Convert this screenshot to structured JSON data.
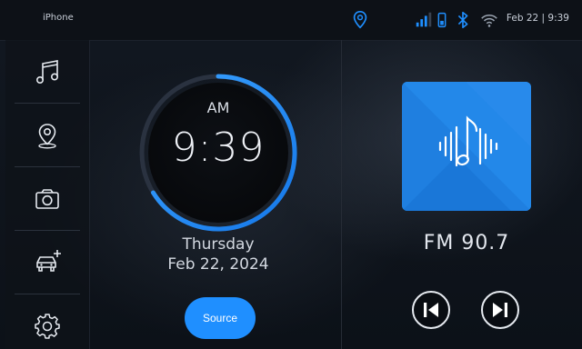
{
  "status_bar": {
    "device_name": "iPhone",
    "date_time": "Feb 22 | 9:39",
    "icons": [
      "location-pin-icon",
      "signal-bars-icon",
      "phone-battery-icon",
      "bluetooth-icon",
      "wifi-icon"
    ]
  },
  "sidebar": {
    "items": [
      {
        "name": "music",
        "icon": "music-note-icon"
      },
      {
        "name": "navigation",
        "icon": "map-pin-icon"
      },
      {
        "name": "camera",
        "icon": "camera-icon"
      },
      {
        "name": "add-vehicle",
        "icon": "car-plus-icon"
      },
      {
        "name": "settings",
        "icon": "gear-icon"
      }
    ]
  },
  "clock": {
    "ampm": "AM",
    "time": "9:39",
    "day": "Thursday",
    "date": "Feb 22, 2024"
  },
  "source_button": {
    "label": "Source"
  },
  "media": {
    "station": "FM  90.7",
    "album_icon": "music-waveform-icon",
    "controls": [
      "previous-track-icon",
      "next-track-icon"
    ]
  },
  "colors": {
    "accent": "#1f8fff",
    "background": "#0d1117",
    "album_blue": "#1f7fe0"
  }
}
